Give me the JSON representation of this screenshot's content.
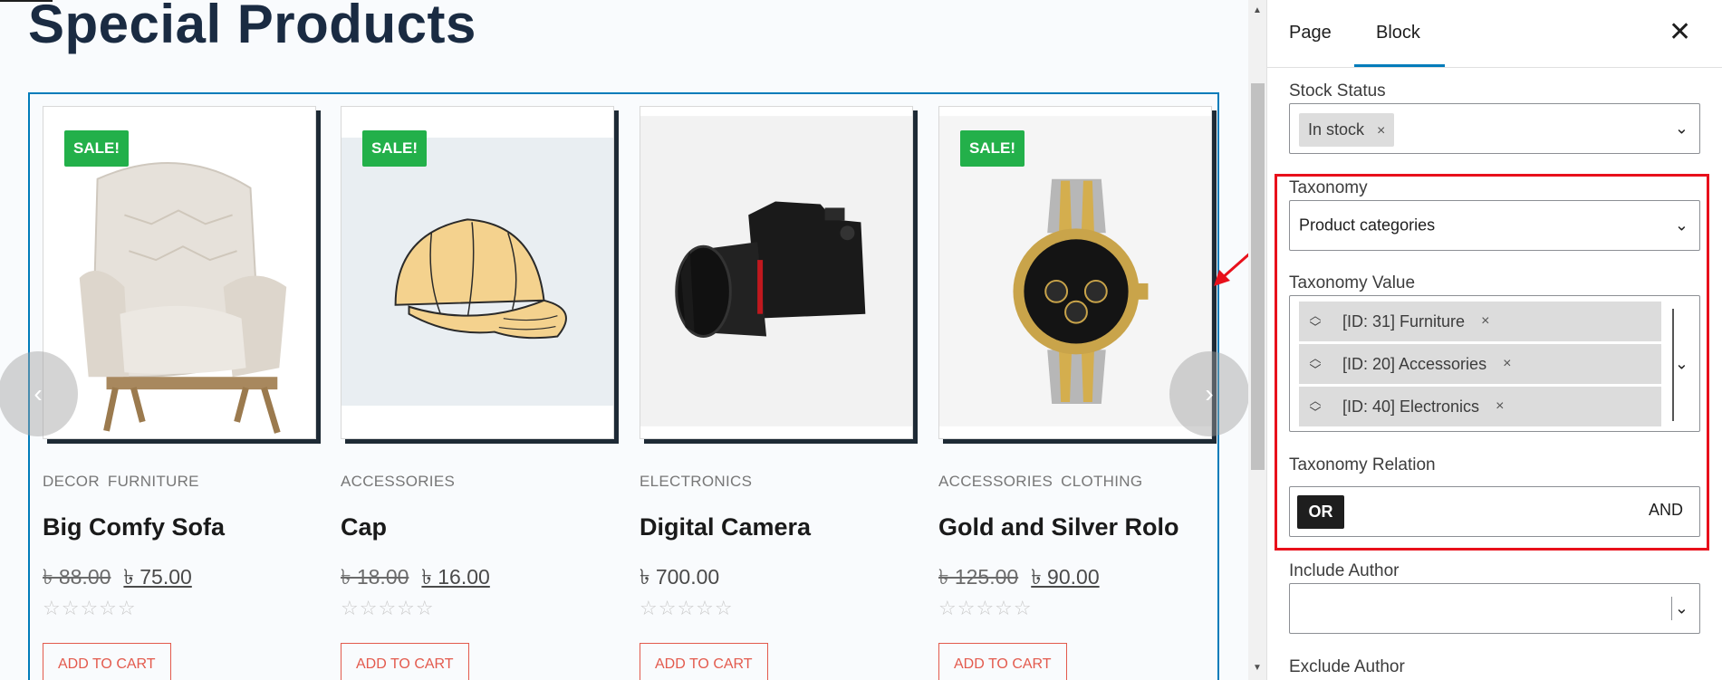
{
  "page": {
    "title": "Special Products",
    "prev_arrow": "‹",
    "next_arrow": "›"
  },
  "products": [
    {
      "sale": "SALE!",
      "categories": [
        "DECOR",
        "FURNITURE"
      ],
      "name": "Big Comfy Sofa",
      "old_price": "৳ 88.00",
      "price": "৳ 75.00",
      "rating": "☆☆☆☆☆",
      "cart": "ADD TO CART"
    },
    {
      "sale": "SALE!",
      "categories": [
        "ACCESSORIES"
      ],
      "name": "Cap",
      "old_price": "৳ 18.00",
      "price": "৳ 16.00",
      "rating": "☆☆☆☆☆",
      "cart": "ADD TO CART"
    },
    {
      "categories": [
        "ELECTRONICS"
      ],
      "name": "Digital Camera",
      "price": "৳ 700.00",
      "rating": "☆☆☆☆☆",
      "cart": "ADD TO CART"
    },
    {
      "sale": "SALE!",
      "categories": [
        "ACCESSORIES",
        "CLOTHING"
      ],
      "name": "Gold and Silver Rolo",
      "old_price": "৳ 125.00",
      "price": "৳ 90.00",
      "rating": "☆☆☆☆☆",
      "cart": "ADD TO CART"
    }
  ],
  "sidebar": {
    "tabs": {
      "page": "Page",
      "block": "Block"
    },
    "close": "✕",
    "stock_status": {
      "label": "Stock Status",
      "chip": "In stock",
      "chip_remove": "×"
    },
    "taxonomy": {
      "label": "Taxonomy",
      "value": "Product categories"
    },
    "taxonomy_value": {
      "label": "Taxonomy Value",
      "items": [
        "[ID: 31] Furniture",
        "[ID: 20] Accessories",
        "[ID: 40] Electronics"
      ],
      "remove": "×",
      "mover_up": "︿",
      "mover_down": "﹀"
    },
    "taxonomy_relation": {
      "label": "Taxonomy Relation",
      "or": "OR",
      "and": "AND",
      "selected": "OR"
    },
    "include_author": {
      "label": "Include Author",
      "value": ""
    },
    "exclude_author": {
      "label": "Exclude Author"
    },
    "chevron": "⌄",
    "accent": "#007cba",
    "highlight_color": "#e8101b"
  }
}
